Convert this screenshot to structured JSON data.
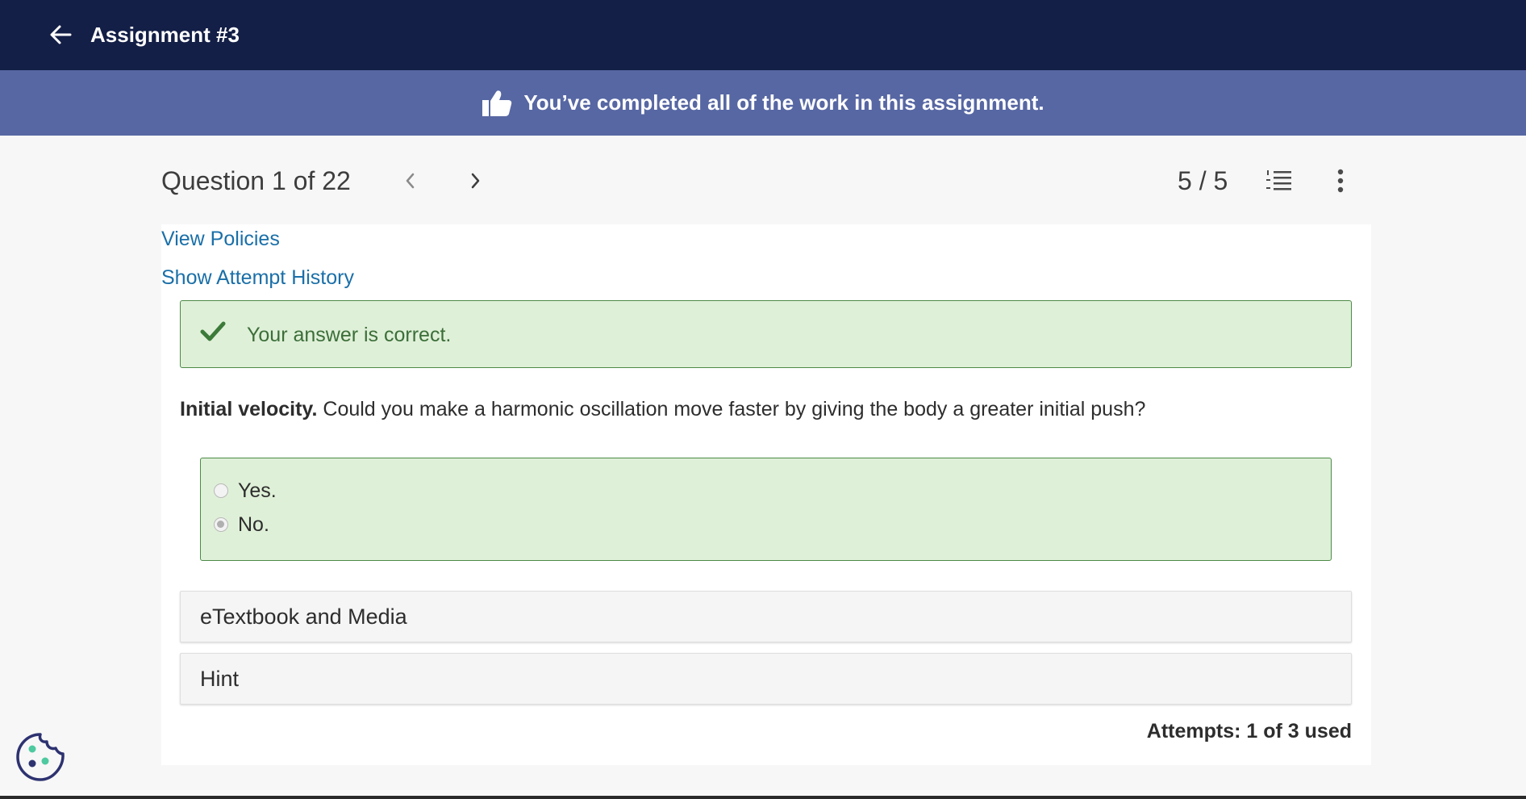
{
  "topbar": {
    "title": "Assignment #3",
    "back_icon": "arrow-left-icon"
  },
  "banner": {
    "text": "You’ve completed all of the work in this assignment.",
    "icon": "thumbs-up-icon"
  },
  "question_header": {
    "title": "Question 1 of 22",
    "score": "5 / 5"
  },
  "links": {
    "view_policies": "View Policies",
    "show_attempt_history": "Show Attempt History"
  },
  "feedback": {
    "text": "Your answer is correct."
  },
  "question": {
    "bold_label": "Initial velocity.",
    "text": " Could you make a harmonic oscillation move faster by giving the body a greater initial push?"
  },
  "options": [
    {
      "label": "Yes.",
      "selected": false
    },
    {
      "label": "No.",
      "selected": true
    }
  ],
  "sections": {
    "media": "eTextbook and Media",
    "hint": "Hint"
  },
  "attempts": "Attempts: 1 of 3 used",
  "colors": {
    "topbar": "#141f47",
    "banner": "#5767a3",
    "correct_bg": "#dff0d8",
    "correct_border": "#4c8a47",
    "link": "#1a6fa8"
  }
}
